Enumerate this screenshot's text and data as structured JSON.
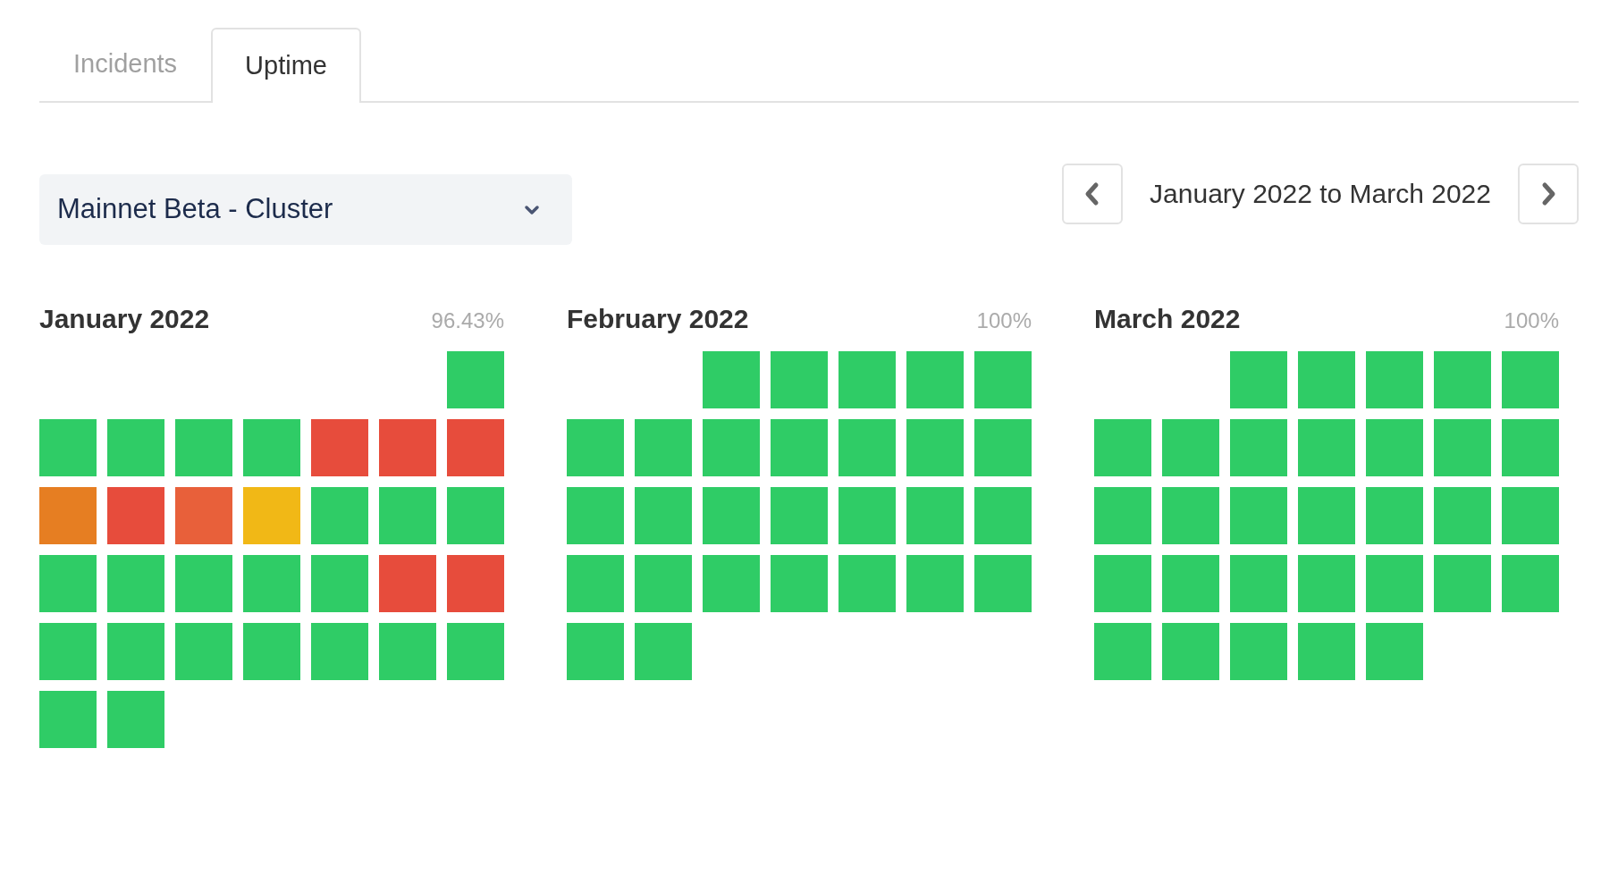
{
  "tabs": [
    {
      "label": "Incidents",
      "selected": false
    },
    {
      "label": "Uptime",
      "selected": true
    }
  ],
  "component_select": {
    "value": "Mainnet Beta - Cluster"
  },
  "date_range": {
    "label": "January 2022 to March 2022"
  },
  "months": [
    {
      "title": "January 2022",
      "uptime": "96.43%",
      "days": [
        {
          "kind": "blank"
        },
        {
          "kind": "blank"
        },
        {
          "kind": "blank"
        },
        {
          "kind": "blank"
        },
        {
          "kind": "blank"
        },
        {
          "kind": "blank"
        },
        {
          "kind": "day",
          "color": "#2fcc66"
        },
        {
          "kind": "day",
          "color": "#2fcc66"
        },
        {
          "kind": "day",
          "color": "#2fcc66"
        },
        {
          "kind": "day",
          "color": "#2fcc66"
        },
        {
          "kind": "day",
          "color": "#2fcc66"
        },
        {
          "kind": "day",
          "color": "#e74c3c"
        },
        {
          "kind": "day",
          "color": "#e74c3c"
        },
        {
          "kind": "day",
          "color": "#e74c3c"
        },
        {
          "kind": "day",
          "color": "#e67e22"
        },
        {
          "kind": "day",
          "color": "#e74c3c"
        },
        {
          "kind": "day",
          "color": "#e8603a"
        },
        {
          "kind": "day",
          "color": "#f1b816"
        },
        {
          "kind": "day",
          "color": "#2fcc66"
        },
        {
          "kind": "day",
          "color": "#2fcc66"
        },
        {
          "kind": "day",
          "color": "#2fcc66"
        },
        {
          "kind": "day",
          "color": "#2fcc66"
        },
        {
          "kind": "day",
          "color": "#2fcc66"
        },
        {
          "kind": "day",
          "color": "#2fcc66"
        },
        {
          "kind": "day",
          "color": "#2fcc66"
        },
        {
          "kind": "day",
          "color": "#2fcc66"
        },
        {
          "kind": "day",
          "color": "#e74c3c"
        },
        {
          "kind": "day",
          "color": "#e74c3c"
        },
        {
          "kind": "day",
          "color": "#2fcc66"
        },
        {
          "kind": "day",
          "color": "#2fcc66"
        },
        {
          "kind": "day",
          "color": "#2fcc66"
        },
        {
          "kind": "day",
          "color": "#2fcc66"
        },
        {
          "kind": "day",
          "color": "#2fcc66"
        },
        {
          "kind": "day",
          "color": "#2fcc66"
        },
        {
          "kind": "day",
          "color": "#2fcc66"
        },
        {
          "kind": "day",
          "color": "#2fcc66"
        },
        {
          "kind": "day",
          "color": "#2fcc66"
        }
      ]
    },
    {
      "title": "February 2022",
      "uptime": "100%",
      "days": [
        {
          "kind": "blank"
        },
        {
          "kind": "blank"
        },
        {
          "kind": "day",
          "color": "#2fcc66"
        },
        {
          "kind": "day",
          "color": "#2fcc66"
        },
        {
          "kind": "day",
          "color": "#2fcc66"
        },
        {
          "kind": "day",
          "color": "#2fcc66"
        },
        {
          "kind": "day",
          "color": "#2fcc66"
        },
        {
          "kind": "day",
          "color": "#2fcc66"
        },
        {
          "kind": "day",
          "color": "#2fcc66"
        },
        {
          "kind": "day",
          "color": "#2fcc66"
        },
        {
          "kind": "day",
          "color": "#2fcc66"
        },
        {
          "kind": "day",
          "color": "#2fcc66"
        },
        {
          "kind": "day",
          "color": "#2fcc66"
        },
        {
          "kind": "day",
          "color": "#2fcc66"
        },
        {
          "kind": "day",
          "color": "#2fcc66"
        },
        {
          "kind": "day",
          "color": "#2fcc66"
        },
        {
          "kind": "day",
          "color": "#2fcc66"
        },
        {
          "kind": "day",
          "color": "#2fcc66"
        },
        {
          "kind": "day",
          "color": "#2fcc66"
        },
        {
          "kind": "day",
          "color": "#2fcc66"
        },
        {
          "kind": "day",
          "color": "#2fcc66"
        },
        {
          "kind": "day",
          "color": "#2fcc66"
        },
        {
          "kind": "day",
          "color": "#2fcc66"
        },
        {
          "kind": "day",
          "color": "#2fcc66"
        },
        {
          "kind": "day",
          "color": "#2fcc66"
        },
        {
          "kind": "day",
          "color": "#2fcc66"
        },
        {
          "kind": "day",
          "color": "#2fcc66"
        },
        {
          "kind": "day",
          "color": "#2fcc66"
        },
        {
          "kind": "day",
          "color": "#2fcc66"
        },
        {
          "kind": "day",
          "color": "#2fcc66"
        }
      ]
    },
    {
      "title": "March 2022",
      "uptime": "100%",
      "days": [
        {
          "kind": "blank"
        },
        {
          "kind": "blank"
        },
        {
          "kind": "day",
          "color": "#2fcc66"
        },
        {
          "kind": "day",
          "color": "#2fcc66"
        },
        {
          "kind": "day",
          "color": "#2fcc66"
        },
        {
          "kind": "day",
          "color": "#2fcc66"
        },
        {
          "kind": "day",
          "color": "#2fcc66"
        },
        {
          "kind": "day",
          "color": "#2fcc66"
        },
        {
          "kind": "day",
          "color": "#2fcc66"
        },
        {
          "kind": "day",
          "color": "#2fcc66"
        },
        {
          "kind": "day",
          "color": "#2fcc66"
        },
        {
          "kind": "day",
          "color": "#2fcc66"
        },
        {
          "kind": "day",
          "color": "#2fcc66"
        },
        {
          "kind": "day",
          "color": "#2fcc66"
        },
        {
          "kind": "day",
          "color": "#2fcc66"
        },
        {
          "kind": "day",
          "color": "#2fcc66"
        },
        {
          "kind": "day",
          "color": "#2fcc66"
        },
        {
          "kind": "day",
          "color": "#2fcc66"
        },
        {
          "kind": "day",
          "color": "#2fcc66"
        },
        {
          "kind": "day",
          "color": "#2fcc66"
        },
        {
          "kind": "day",
          "color": "#2fcc66"
        },
        {
          "kind": "day",
          "color": "#2fcc66"
        },
        {
          "kind": "day",
          "color": "#2fcc66"
        },
        {
          "kind": "day",
          "color": "#2fcc66"
        },
        {
          "kind": "day",
          "color": "#2fcc66"
        },
        {
          "kind": "day",
          "color": "#2fcc66"
        },
        {
          "kind": "day",
          "color": "#2fcc66"
        },
        {
          "kind": "day",
          "color": "#2fcc66"
        },
        {
          "kind": "day",
          "color": "#2fcc66"
        },
        {
          "kind": "day",
          "color": "#2fcc66"
        },
        {
          "kind": "day",
          "color": "#2fcc66"
        },
        {
          "kind": "day",
          "color": "#2fcc66"
        },
        {
          "kind": "day",
          "color": "#2fcc66"
        }
      ]
    }
  ]
}
